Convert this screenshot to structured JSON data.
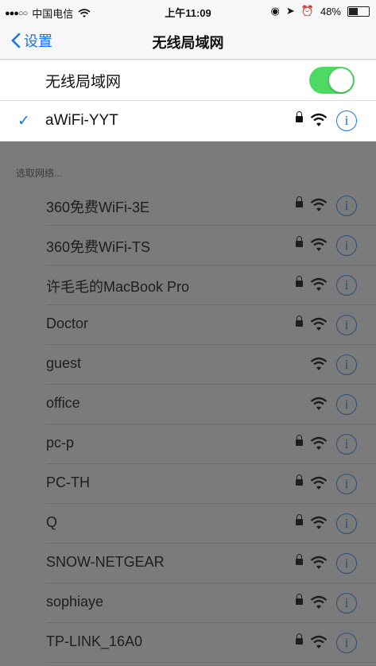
{
  "status_bar": {
    "carrier": "中国电信",
    "time": "上午11:09",
    "battery": "48%",
    "battery_level": 0.48
  },
  "nav": {
    "back_label": "设置",
    "title": "无线局域网"
  },
  "wifi_toggle": {
    "label": "无线局域网",
    "on": true
  },
  "connected": {
    "name": "aWiFi-YYT",
    "locked": true
  },
  "section_header": "选取网络...",
  "networks": [
    {
      "name": "360免费WiFi-3E",
      "locked": true
    },
    {
      "name": "360免费WiFi-TS",
      "locked": true
    },
    {
      "name": "许毛毛的MacBook Pro",
      "locked": true
    },
    {
      "name": "Doctor",
      "locked": true
    },
    {
      "name": "guest",
      "locked": false
    },
    {
      "name": "office",
      "locked": false
    },
    {
      "name": "pc-p",
      "locked": true
    },
    {
      "name": "PC-TH",
      "locked": true
    },
    {
      "name": "Q",
      "locked": true
    },
    {
      "name": "SNOW-NETGEAR",
      "locked": true
    },
    {
      "name": "sophiaye",
      "locked": true
    },
    {
      "name": "TP-LINK_16A0",
      "locked": true
    }
  ],
  "colors": {
    "accent": "#1a73e8",
    "toggle_on": "#4cd964",
    "dim_overlay": "#7b7b7b"
  }
}
